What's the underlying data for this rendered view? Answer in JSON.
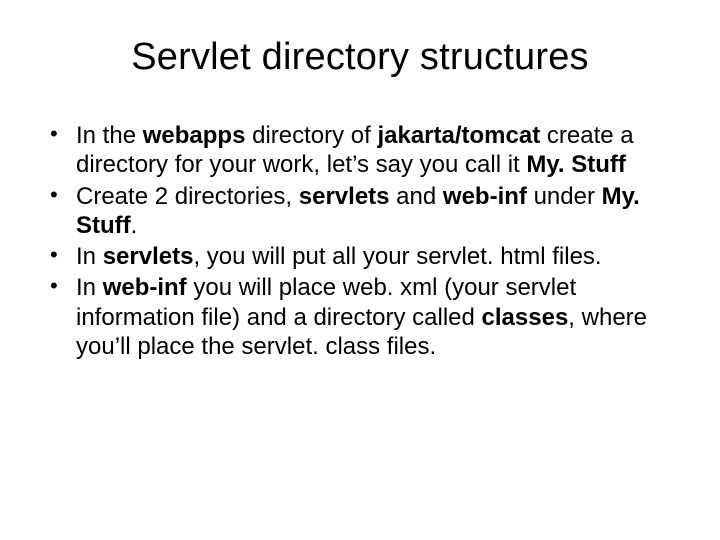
{
  "title": "Servlet directory structures",
  "bullets": [
    {
      "runs": [
        {
          "t": "In the "
        },
        {
          "t": "webapps",
          "b": true
        },
        {
          "t": " directory of "
        },
        {
          "t": "jakarta/tomcat",
          "b": true
        },
        {
          "t": " create a directory for your work, let’s say you call it "
        },
        {
          "t": "My. Stuff",
          "b": true
        }
      ]
    },
    {
      "runs": [
        {
          "t": "Create 2 directories, "
        },
        {
          "t": "servlets",
          "b": true
        },
        {
          "t": " and "
        },
        {
          "t": "web-inf",
          "b": true
        },
        {
          "t": " under "
        },
        {
          "t": "My. Stuff",
          "b": true
        },
        {
          "t": "."
        }
      ]
    },
    {
      "runs": [
        {
          "t": "In "
        },
        {
          "t": "servlets",
          "b": true
        },
        {
          "t": ", you will put all your servlet. html files."
        }
      ]
    },
    {
      "runs": [
        {
          "t": "In "
        },
        {
          "t": "web-inf",
          "b": true
        },
        {
          "t": " you will place web. xml (your servlet information file) and a directory called "
        },
        {
          "t": "classes",
          "b": true
        },
        {
          "t": ", where you’ll place the servlet. class files."
        }
      ]
    }
  ]
}
